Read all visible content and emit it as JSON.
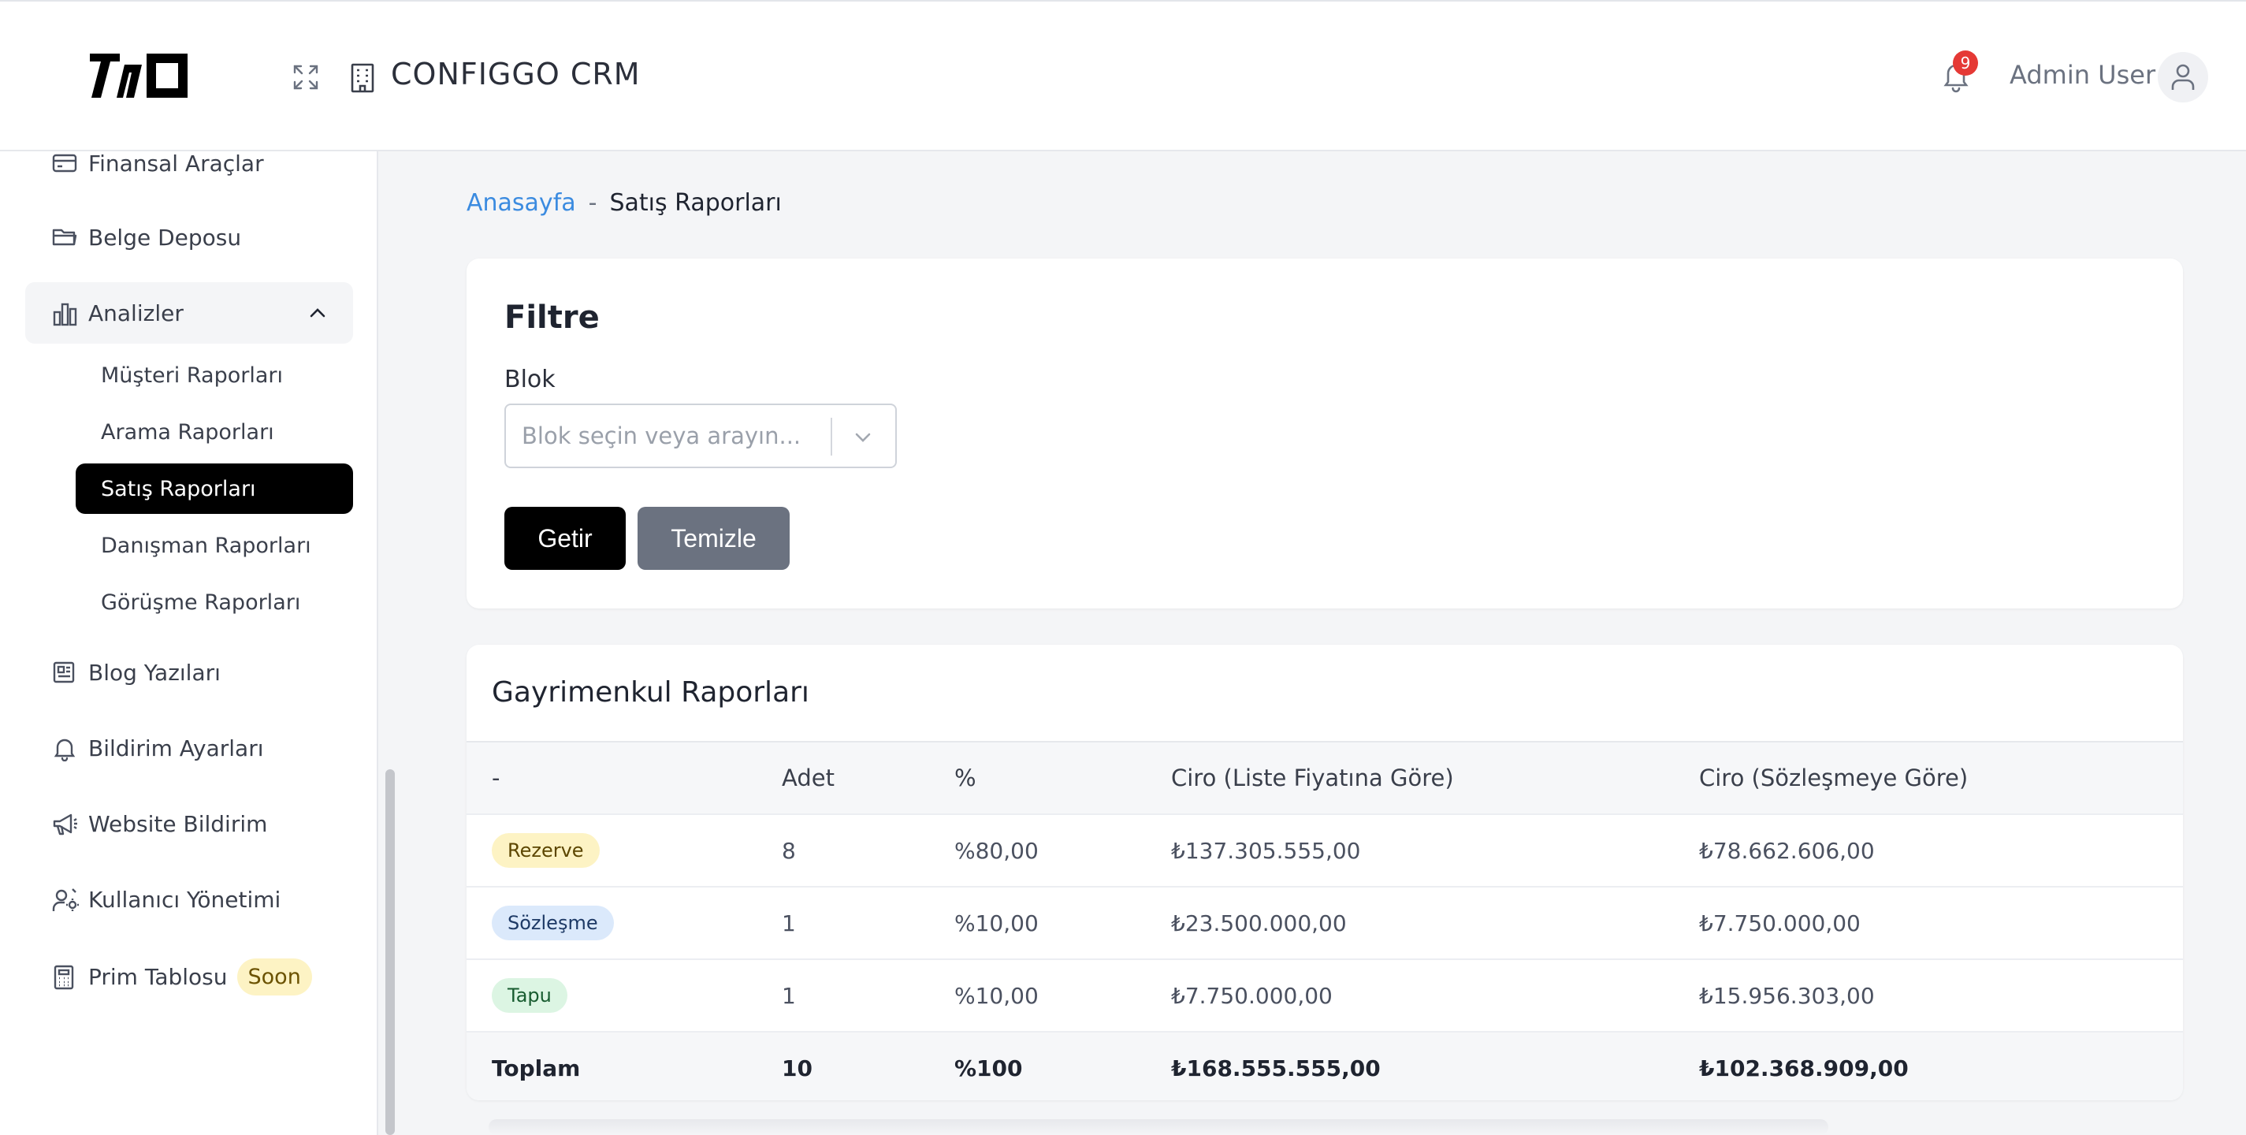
{
  "header": {
    "app_title": "CONFIGGO  CRM",
    "notification_count": "9",
    "user_name": "Admin User"
  },
  "sidebar": {
    "items": [
      {
        "label": "Finansal Araçlar",
        "icon": "credit-card-icon"
      },
      {
        "label": "Belge Deposu",
        "icon": "folder-icon"
      },
      {
        "label": "Analizler",
        "icon": "bar-chart-icon",
        "expanded": true
      },
      {
        "label": "Blog Yazıları",
        "icon": "newspaper-icon"
      },
      {
        "label": "Bildirim Ayarları",
        "icon": "bell-icon"
      },
      {
        "label": "Website Bildirim",
        "icon": "megaphone-icon"
      },
      {
        "label": "Kullanıcı Yönetimi",
        "icon": "users-cog-icon"
      },
      {
        "label": "Prim Tablosu",
        "icon": "calculator-icon",
        "badge": "Soon"
      }
    ],
    "analytics_sub": [
      {
        "label": "Müşteri Raporları"
      },
      {
        "label": "Arama Raporları"
      },
      {
        "label": "Satış Raporları",
        "active": true
      },
      {
        "label": "Danışman Raporları"
      },
      {
        "label": "Görüşme Raporları"
      }
    ]
  },
  "breadcrumb": {
    "home": "Anasayfa",
    "separator": "-",
    "current": "Satış Raporları"
  },
  "filter": {
    "title": "Filtre",
    "block_label": "Blok",
    "block_placeholder": "Blok seçin veya arayın...",
    "get_button": "Getir",
    "clear_button": "Temizle"
  },
  "report": {
    "title": "Gayrimenkul Raporları",
    "columns": [
      "-",
      "Adet",
      "%",
      "Ciro (Liste Fiyatına Göre)",
      "Ciro (Sözleşmeye Göre)"
    ],
    "rows": [
      {
        "status": "Rezerve",
        "count": "8",
        "percent": "%80,00",
        "list_revenue": "₺137.305.555,00",
        "contract_revenue": "₺78.662.606,00"
      },
      {
        "status": "Sözleşme",
        "count": "1",
        "percent": "%10,00",
        "list_revenue": "₺23.500.000,00",
        "contract_revenue": "₺7.750.000,00"
      },
      {
        "status": "Tapu",
        "count": "1",
        "percent": "%10,00",
        "list_revenue": "₺7.750.000,00",
        "contract_revenue": "₺15.956.303,00"
      }
    ],
    "total": {
      "label": "Toplam",
      "count": "10",
      "percent": "%100",
      "list_revenue": "₺168.555.555,00",
      "contract_revenue": "₺102.368.909,00"
    }
  },
  "colors": {
    "accent_link": "#3b8be0",
    "active_nav": "#000000",
    "notification_badge": "#e53935",
    "status_rezerve": "#fdf3c4",
    "status_sozlesme": "#dbe9fb",
    "status_tapu": "#dcf5e3"
  }
}
